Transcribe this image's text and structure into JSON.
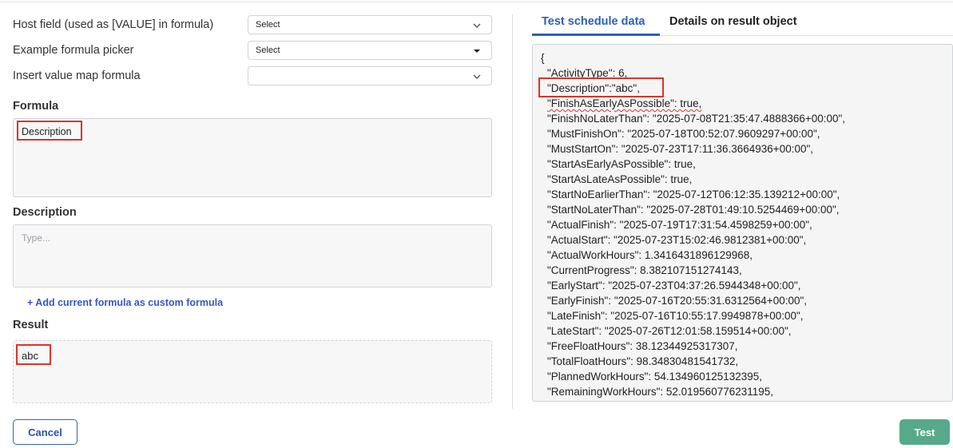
{
  "fields": [
    {
      "label": "Host field (used as [VALUE] in formula)",
      "value": "Select",
      "icon": "chevron-down-icon"
    },
    {
      "label": "Example formula picker",
      "value": "Select",
      "icon": "caret-down-icon"
    },
    {
      "label": "Insert value map formula",
      "value": "",
      "icon": "chevron-down-icon"
    }
  ],
  "formula": {
    "title": "Formula",
    "value": "Description"
  },
  "description": {
    "title": "Description",
    "placeholder": "Type..."
  },
  "add_link": "+ Add current formula as custom formula",
  "result": {
    "title": "Result",
    "value": "abc"
  },
  "tabs": [
    {
      "label": "Test schedule data",
      "active": true
    },
    {
      "label": "Details on result object",
      "active": false
    }
  ],
  "json_lines": [
    "{",
    "\"ActivityType\": 6,",
    "\"Description\":\"abc\",",
    "\"FinishAsEarlyAsPossible\": true,",
    "\"FinishNoLaterThan\": \"2025-07-08T21:35:47.4888366+00:00\",",
    "\"MustFinishOn\": \"2025-07-18T00:52:07.9609297+00:00\",",
    "\"MustStartOn\": \"2025-07-23T17:11:36.3664936+00:00\",",
    "\"StartAsEarlyAsPossible\": true,",
    "\"StartAsLateAsPossible\": true,",
    "\"StartNoEarlierThan\": \"2025-07-12T06:12:35.139212+00:00\",",
    "\"StartNoLaterThan\": \"2025-07-28T01:49:10.5254469+00:00\",",
    "\"ActualFinish\": \"2025-07-19T17:31:54.4598259+00:00\",",
    "\"ActualStart\": \"2025-07-23T15:02:46.9812381+00:00\",",
    "\"ActualWorkHours\": 1.3416431896129968,",
    "\"CurrentProgress\": 8.382107151274143,",
    "\"EarlyStart\": \"2025-07-23T04:37:26.5944348+00:00\",",
    "\"EarlyFinish\": \"2025-07-16T20:55:31.6312564+00:00\",",
    "\"LateFinish\": \"2025-07-16T10:55:17.9949878+00:00\",",
    "\"LateStart\": \"2025-07-26T12:01:58.159514+00:00\",",
    "\"FreeFloatHours\": 38.12344925317307,",
    "\"TotalFloatHours\": 98.34830481541732,",
    "\"PlannedWorkHours\": 54.134960125132395,",
    "\"RemainingWorkHours\": 52.019560776231195,"
  ],
  "buttons": {
    "cancel": "Cancel",
    "test": "Test"
  },
  "colors": {
    "accent": "#2e5fb8",
    "highlight": "#d9342b",
    "test_button": "#56a98a",
    "link": "#3358c4"
  }
}
